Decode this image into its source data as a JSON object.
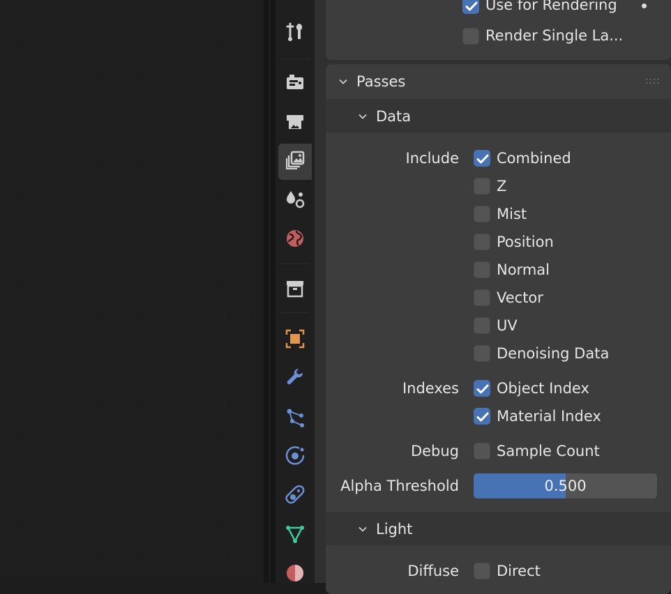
{
  "top": {
    "use_for_rendering_label": "Use for Rendering",
    "render_single_layer_label": "Render Single La..."
  },
  "passes": {
    "title": "Passes",
    "data": {
      "title": "Data",
      "include_label": "Include",
      "include_items": [
        {
          "label": "Combined",
          "checked": true
        },
        {
          "label": "Z",
          "checked": false
        },
        {
          "label": "Mist",
          "checked": false
        },
        {
          "label": "Position",
          "checked": false
        },
        {
          "label": "Normal",
          "checked": false
        },
        {
          "label": "Vector",
          "checked": false
        },
        {
          "label": "UV",
          "checked": false
        },
        {
          "label": "Denoising Data",
          "checked": false
        }
      ],
      "indexes_label": "Indexes",
      "indexes_items": [
        {
          "label": "Object Index",
          "checked": true
        },
        {
          "label": "Material Index",
          "checked": true
        }
      ],
      "debug_label": "Debug",
      "debug_items": [
        {
          "label": "Sample Count",
          "checked": false
        }
      ],
      "alpha_threshold_label": "Alpha Threshold",
      "alpha_threshold_value": "0.500",
      "alpha_threshold_fraction": 0.5
    },
    "light": {
      "title": "Light",
      "diffuse_label": "Diffuse",
      "diffuse_items": [
        {
          "label": "Direct",
          "checked": false
        }
      ]
    }
  },
  "tabs": [
    {
      "icon": "tool-icon",
      "active": false
    },
    {
      "icon": "render-icon",
      "active": false
    },
    {
      "icon": "output-icon",
      "active": false
    },
    {
      "icon": "view-layer-icon",
      "active": true
    },
    {
      "icon": "scene-icon",
      "active": false
    },
    {
      "icon": "world-icon",
      "active": false
    },
    {
      "icon": "collection-icon",
      "active": false
    },
    {
      "icon": "object-icon",
      "active": false
    },
    {
      "icon": "modifier-wrench-icon",
      "active": false
    },
    {
      "icon": "particles-icon",
      "active": false
    },
    {
      "icon": "physics-icon",
      "active": false
    },
    {
      "icon": "object-constraint-icon",
      "active": false
    },
    {
      "icon": "mesh-data-icon",
      "active": false
    },
    {
      "icon": "material-icon",
      "active": false
    }
  ],
  "colors": {
    "accent": "#4772b3",
    "panel": "#3d3d3d",
    "text": "#e6e6e6"
  }
}
